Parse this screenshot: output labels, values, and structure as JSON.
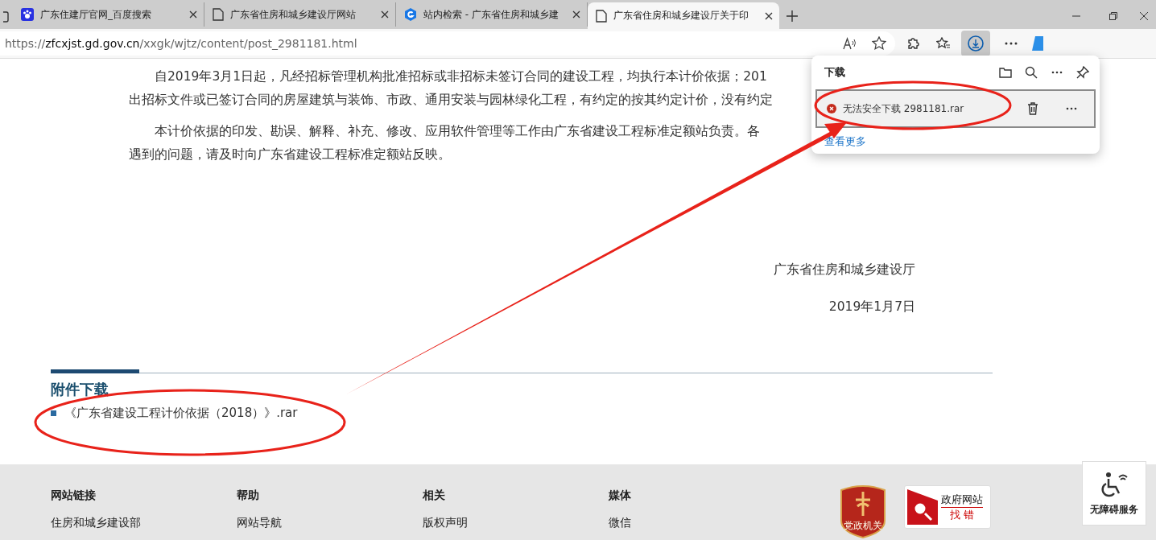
{
  "tabs": [
    {
      "kind": "paw",
      "title": "广东住建厅官网_百度搜索",
      "selected": false
    },
    {
      "kind": "page",
      "title": "广东省住房和城乡建设厅网站",
      "selected": false
    },
    {
      "kind": "shield",
      "title": "站内检索 - 广东省住房和城乡建",
      "selected": false
    },
    {
      "kind": "page",
      "title": "广东省住房和城乡建设厅关于印",
      "selected": true
    }
  ],
  "address_bar": {
    "url_prefix": "https://",
    "url_host": "zfcxjst.gd.gov.cn",
    "url_path": "/xxgk/wjtz/content/post_2981181.html"
  },
  "article": {
    "paragraphs": [
      [
        "自2019年3月1日起，凡经招标管理机构批准招标或非招标未签订合同的建设工程，均执行本计价依据；201",
        "出招标文件或已签订合同的房屋建筑与装饰、市政、通用安装与园林绿化工程，有约定的按其约定计价，没有约定"
      ],
      [
        "本计价依据的印发、勘误、解释、补充、修改、应用软件管理等工作由广东省建设工程标准定额站负责。各",
        "遇到的问题，请及时向广东省建设工程标准定额站反映。"
      ]
    ],
    "signature": "广东省住房和城乡建设厅",
    "date": "2019年1月7日"
  },
  "attachments": {
    "heading": "附件下载",
    "items": [
      "《广东省建设工程计价依据（2018）》.rar"
    ]
  },
  "footer": {
    "columns": [
      {
        "heading": "网站链接",
        "links": [
          "住房和城乡建设部"
        ]
      },
      {
        "heading": "帮助",
        "links": [
          "网站导航"
        ]
      },
      {
        "heading": "相关",
        "links": [
          "版权声明"
        ]
      },
      {
        "heading": "媒体",
        "links": [
          "微信"
        ]
      }
    ],
    "badge": "党政机关",
    "report": {
      "title": "政府网站",
      "subtitle": "找 错"
    }
  },
  "accessibility_button": "无障碍服务",
  "downloads_panel": {
    "title": "下载",
    "items": [
      {
        "kind": "error",
        "text": "无法安全下载 2981181.rar"
      }
    ],
    "more_link": "查看更多"
  }
}
